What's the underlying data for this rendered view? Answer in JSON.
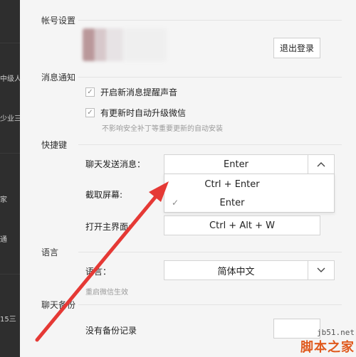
{
  "sidebar_snippets": [
    "中级人",
    "少业三",
    "家",
    "通",
    "15三"
  ],
  "sections": {
    "account": {
      "label": "帐号设置",
      "logout_button": "退出登录"
    },
    "notifications": {
      "label": "消息通知",
      "sound_label": "开启新消息提醒声音",
      "auto_upgrade_label": "有更新时自动升级微信",
      "auto_upgrade_hint": "不影响安全补丁等重要更新的自动安装"
    },
    "shortcuts": {
      "label": "快捷键",
      "send_message_label": "聊天发送消息：",
      "send_message_value": "Enter",
      "screenshot_label": "截取屏幕:",
      "open_main_label": "打开主界面:",
      "open_main_value": "Ctrl + Alt + W",
      "dropdown_options": [
        {
          "label": "Ctrl + Enter",
          "selected": false
        },
        {
          "label": "Enter",
          "selected": true
        }
      ]
    },
    "language": {
      "label": "语言",
      "field_label": "语言：",
      "value": "简体中文",
      "hint": "重启微信生效"
    },
    "backup": {
      "label": "聊天备份",
      "empty_text": "没有备份记录"
    }
  },
  "watermark": {
    "url": "jb51.net",
    "name": "脚本之家"
  },
  "colors": {
    "arrow": "#e53935",
    "dark_sidebar": "#2e2e2e",
    "watermark": "#e05a1e"
  }
}
